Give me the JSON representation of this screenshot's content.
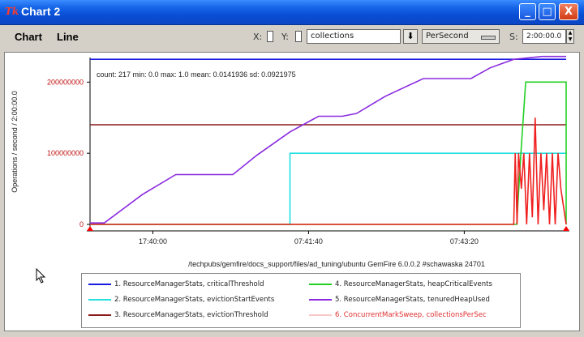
{
  "window": {
    "title": "Chart 2",
    "icon_text": "Tk",
    "min_label": "_",
    "max_label": "□",
    "close_label": "X"
  },
  "menu": {
    "chart": "Chart",
    "line": "Line"
  },
  "toolbar": {
    "x_label": "X:",
    "y_label": "Y:",
    "series_value": "collections",
    "per_value": "PerSecond",
    "s_label": "S:",
    "time_value": "2:00:00.0",
    "drop_arrow": "⬇"
  },
  "chart": {
    "stats_text": "count: 217 min: 0.0 max: 1.0 mean: 0.0141936 sd: 0.0921975",
    "xlabel": "/techpubs/gemfire/docs_support/files/ad_tuning/ubuntu GemFire 6.0.0.2 #schawaska 24701",
    "ylabel": "Operations / second / 2:00:00.0",
    "colors": {
      "axis": "#000000",
      "tick_marker": "#ff0000"
    }
  },
  "chart_data": {
    "type": "line",
    "ylim": [
      0,
      230000000
    ],
    "xlim": [
      0,
      100
    ],
    "yticks": [
      {
        "value": 0,
        "label": "0"
      },
      {
        "value": 100000000,
        "label": "100000000"
      },
      {
        "value": 200000000,
        "label": "200000000"
      }
    ],
    "xticks": [
      {
        "value": 13.2,
        "label": "17:40:00"
      },
      {
        "value": 45.9,
        "label": "07:41:40"
      },
      {
        "value": 78.6,
        "label": "07:43:20"
      }
    ],
    "series": [
      {
        "name": "ResourceManagerStats, criticalThreshold",
        "color": "#1a1ae0",
        "points": [
          [
            0,
            232000000
          ],
          [
            100,
            232000000
          ]
        ]
      },
      {
        "name": "ResourceManagerStats, evictionStartEvents",
        "color": "#22e0e0",
        "points": [
          [
            0,
            0
          ],
          [
            42,
            0
          ],
          [
            42,
            0
          ],
          [
            42,
            100000000
          ],
          [
            100,
            100000000
          ]
        ]
      },
      {
        "name": "ResourceManagerStats, evictionThreshold",
        "color": "#8b1a1a",
        "points": [
          [
            0,
            140000000
          ],
          [
            100,
            140000000
          ]
        ]
      },
      {
        "name": "ResourceManagerStats, heapCriticalEvents",
        "color": "#22d022",
        "points": [
          [
            0,
            0
          ],
          [
            89.6,
            0
          ],
          [
            90.5,
            100000000
          ],
          [
            91.5,
            200000000
          ],
          [
            100,
            200000000
          ],
          [
            100,
            0
          ]
        ]
      },
      {
        "name": "ResourceManagerStats, tenuredHeapUsed",
        "color": "#8a2ae0",
        "points": [
          [
            0,
            2000000
          ],
          [
            3,
            2000000
          ],
          [
            11,
            42000000
          ],
          [
            18,
            70000000
          ],
          [
            22,
            70000000
          ],
          [
            30,
            70000000
          ],
          [
            35,
            97000000
          ],
          [
            42,
            130000000
          ],
          [
            48,
            152000000
          ],
          [
            53,
            152000000
          ],
          [
            56,
            156000000
          ],
          [
            62,
            180000000
          ],
          [
            70,
            205000000
          ],
          [
            80,
            205000000
          ],
          [
            84,
            220000000
          ],
          [
            89,
            232000000
          ],
          [
            95,
            236000000
          ],
          [
            100,
            236000000
          ]
        ]
      },
      {
        "name": "ConcurrentMarkSweep, collectionsPerSec",
        "color": "#f02020",
        "points": [
          [
            0,
            0
          ],
          [
            89,
            0
          ],
          [
            89.3,
            100000000
          ],
          [
            89.7,
            0
          ],
          [
            90,
            100000000
          ],
          [
            90.6,
            50000000
          ],
          [
            91.1,
            100000000
          ],
          [
            91.7,
            0
          ],
          [
            92.3,
            100000000
          ],
          [
            92.9,
            10000000
          ],
          [
            93.5,
            150000000
          ],
          [
            94.1,
            0
          ],
          [
            94.7,
            100000000
          ],
          [
            95.3,
            20000000
          ],
          [
            95.9,
            100000000
          ],
          [
            96.5,
            0
          ],
          [
            97.1,
            100000000
          ],
          [
            97.7,
            0
          ],
          [
            98.3,
            100000000
          ],
          [
            98.9,
            50000000
          ],
          [
            100,
            0
          ]
        ]
      }
    ]
  },
  "legend": [
    {
      "num": "1.",
      "name": "ResourceManagerStats, criticalThreshold",
      "color": "#1a1ae0",
      "text_color": "#222222"
    },
    {
      "num": "2.",
      "name": "ResourceManagerStats, evictionStartEvents",
      "color": "#22e0e0",
      "text_color": "#222222"
    },
    {
      "num": "3.",
      "name": "ResourceManagerStats, evictionThreshold",
      "color": "#8b1a1a",
      "text_color": "#222222"
    },
    {
      "num": "4.",
      "name": "ResourceManagerStats, heapCriticalEvents",
      "color": "#22d022",
      "text_color": "#222222"
    },
    {
      "num": "5.",
      "name": "ResourceManagerStats, tenuredHeapUsed",
      "color": "#8a2ae0",
      "text_color": "#222222"
    },
    {
      "num": "6.",
      "name": "ConcurrentMarkSweep, collectionsPerSec",
      "color": "#f8c8c8",
      "text_color": "#e03030"
    }
  ]
}
